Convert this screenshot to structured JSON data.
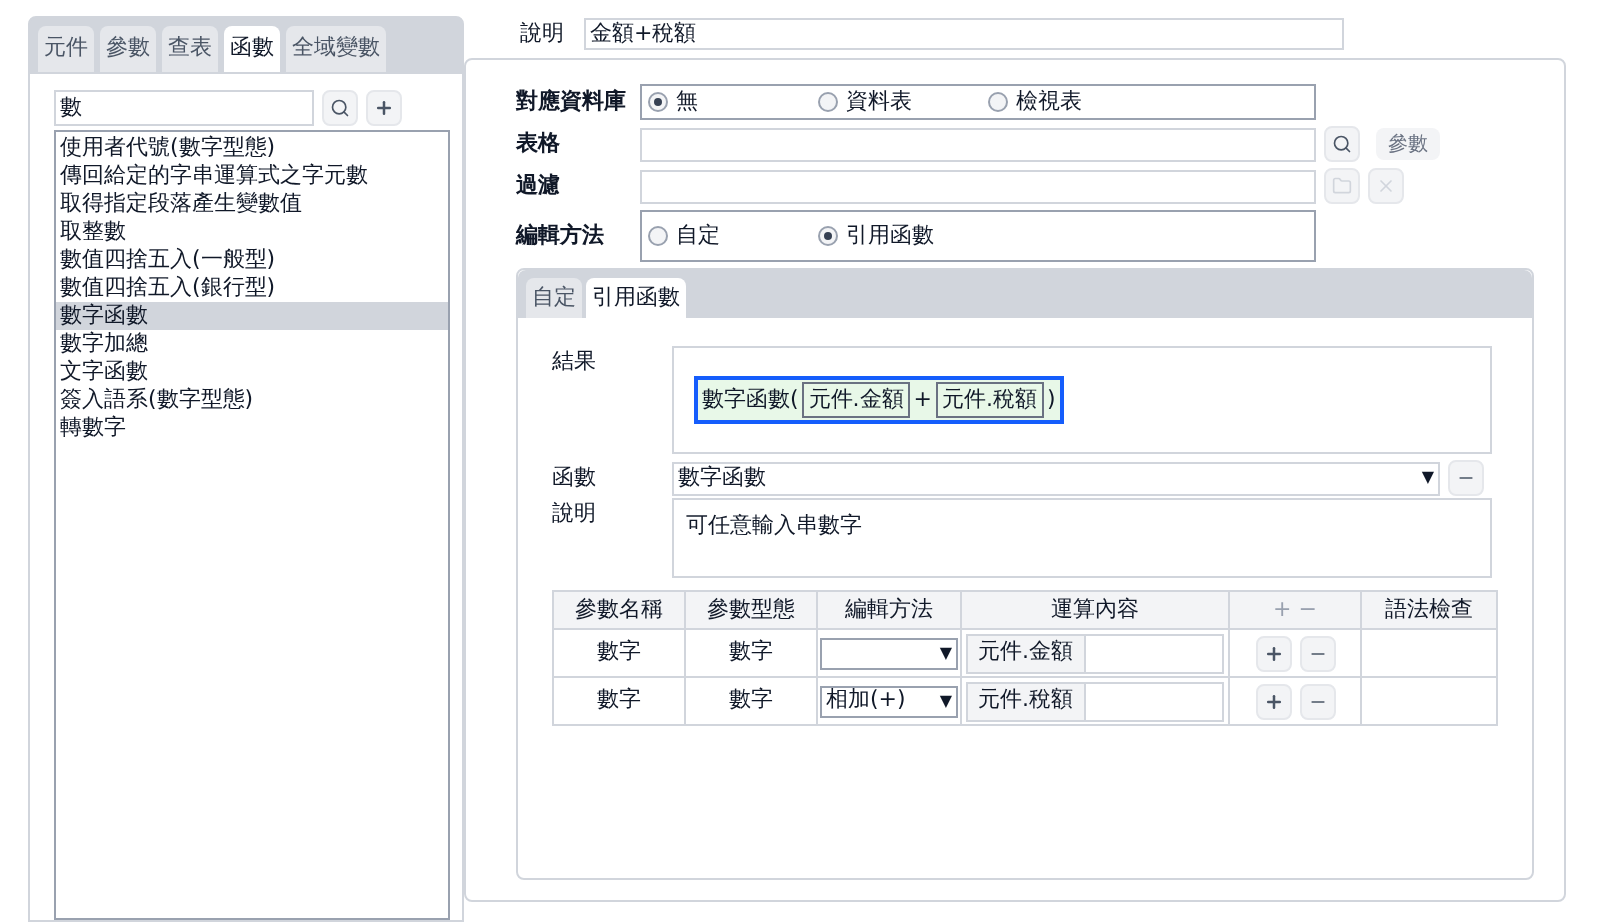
{
  "left_tabs": [
    {
      "label": "元件",
      "selected": false
    },
    {
      "label": "參數",
      "selected": false
    },
    {
      "label": "查表",
      "selected": false
    },
    {
      "label": "函數",
      "selected": true
    },
    {
      "label": "全域變數",
      "selected": false
    }
  ],
  "search": {
    "value": "數"
  },
  "function_list": [
    {
      "label": "使用者代號(數字型態)",
      "selected": false
    },
    {
      "label": "傳回給定的字串運算式之字元數",
      "selected": false
    },
    {
      "label": "取得指定段落產生變數值",
      "selected": false
    },
    {
      "label": "取整數",
      "selected": false
    },
    {
      "label": "數值四捨五入(一般型)",
      "selected": false
    },
    {
      "label": "數值四捨五入(銀行型)",
      "selected": false
    },
    {
      "label": "數字函數",
      "selected": true
    },
    {
      "label": "數字加總",
      "selected": false
    },
    {
      "label": "文字函數",
      "selected": false
    },
    {
      "label": "簽入語系(數字型態)",
      "selected": false
    },
    {
      "label": "轉數字",
      "selected": false
    }
  ],
  "description": {
    "label": "說明",
    "value": "金額+稅額"
  },
  "database": {
    "label": "對應資料庫",
    "options": [
      {
        "label": "無",
        "selected": true
      },
      {
        "label": "資料表",
        "selected": false
      },
      {
        "label": "檢視表",
        "selected": false
      }
    ]
  },
  "table_field": {
    "label": "表格",
    "param_button": "參數"
  },
  "filter_field": {
    "label": "過濾"
  },
  "edit_method": {
    "label": "編輯方法",
    "options": [
      {
        "label": "自定",
        "selected": false
      },
      {
        "label": "引用函數",
        "selected": true
      }
    ]
  },
  "inner_tabs": [
    {
      "label": "自定",
      "selected": false
    },
    {
      "label": "引用函數",
      "selected": true
    }
  ],
  "result": {
    "label": "結果",
    "function": "數字函數(",
    "operands": [
      "元件.金額",
      "元件.稅額"
    ],
    "operator": "+",
    "close": ")"
  },
  "function_field": {
    "label": "函數",
    "value": "數字函數",
    "arrow": "▼"
  },
  "function_description": {
    "label": "說明",
    "value": "可任意輸入串數字"
  },
  "param_table": {
    "columns": [
      "參數名稱",
      "參數型態",
      "編輯方法",
      "運算內容",
      "+ −",
      "語法檢查"
    ],
    "rows": [
      {
        "name": "數字",
        "type": "數字",
        "method": "",
        "content": "元件.金額"
      },
      {
        "name": "數字",
        "type": "數字",
        "method": "相加(+)",
        "content": "元件.稅額"
      }
    ]
  }
}
